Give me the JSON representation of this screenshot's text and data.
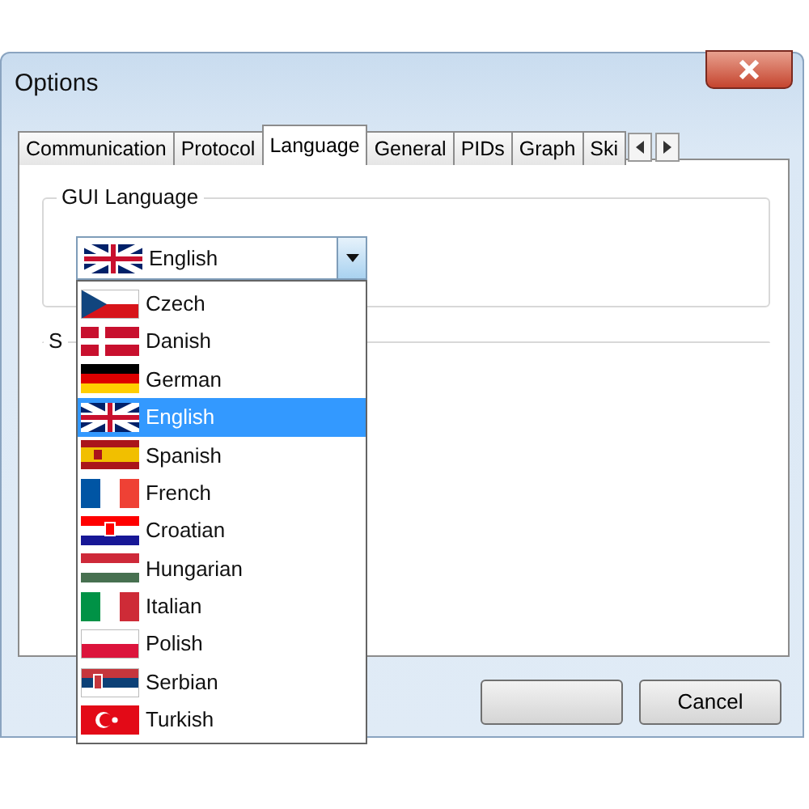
{
  "window": {
    "title": "Options"
  },
  "tabs": [
    {
      "label": "Communication",
      "selected": false
    },
    {
      "label": "Protocol",
      "selected": false
    },
    {
      "label": "Language",
      "selected": true
    },
    {
      "label": "General",
      "selected": false
    },
    {
      "label": "PIDs",
      "selected": false
    },
    {
      "label": "Graph",
      "selected": false
    },
    {
      "label": "Ski",
      "selected": false
    }
  ],
  "gui_language": {
    "label": "GUI Language",
    "value": "English",
    "options": [
      {
        "label": "Czech",
        "selected": false
      },
      {
        "label": "Danish",
        "selected": false
      },
      {
        "label": "German",
        "selected": false
      },
      {
        "label": "English",
        "selected": true
      },
      {
        "label": "Spanish",
        "selected": false
      },
      {
        "label": "French",
        "selected": false
      },
      {
        "label": "Croatian",
        "selected": false
      },
      {
        "label": "Hungarian",
        "selected": false
      },
      {
        "label": "Italian",
        "selected": false
      },
      {
        "label": "Polish",
        "selected": false
      },
      {
        "label": "Serbian",
        "selected": false
      },
      {
        "label": "Turkish",
        "selected": false
      }
    ]
  },
  "second_group": {
    "label": "S"
  },
  "buttons": [
    "Cancel"
  ]
}
